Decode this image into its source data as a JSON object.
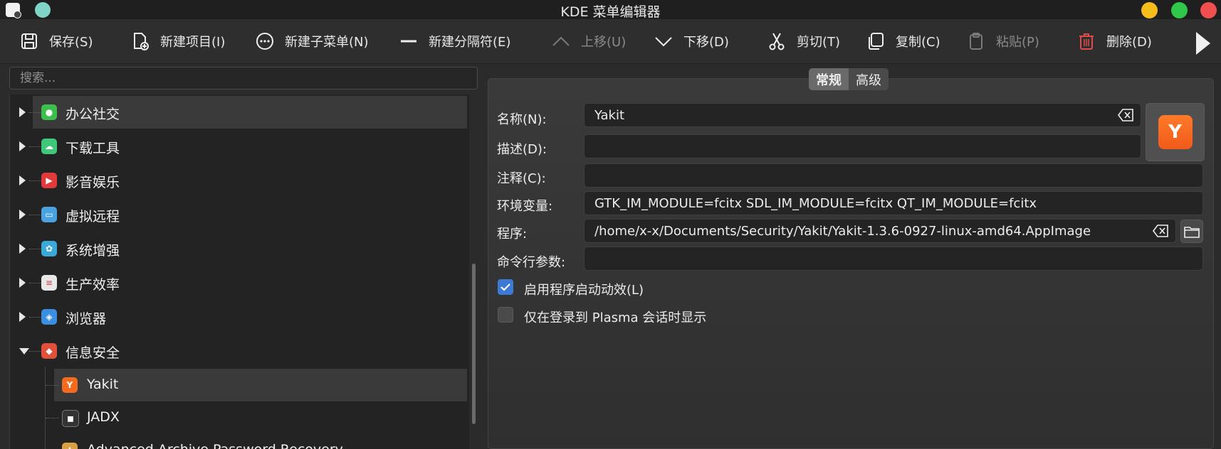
{
  "window": {
    "title": "KDE 菜单编辑器"
  },
  "toolbar": {
    "save": "保存(S)",
    "new_item": "新建项目(I)",
    "new_submenu": "新建子菜单(N)",
    "new_separator": "新建分隔符(E)",
    "move_up": "上移(U)",
    "move_down": "下移(D)",
    "cut": "剪切(T)",
    "copy": "复制(C)",
    "paste": "粘贴(P)",
    "delete": "删除(D)"
  },
  "search": {
    "placeholder": "搜索..."
  },
  "tree": {
    "categories": [
      {
        "label": "办公社交",
        "icon": "wechat-icon",
        "color": "#3dbf4e"
      },
      {
        "label": "下载工具",
        "icon": "cloud-download-icon",
        "color": "#3fc77a"
      },
      {
        "label": "影音娱乐",
        "icon": "media-play-icon",
        "color": "#e23a3a"
      },
      {
        "label": "虚拟远程",
        "icon": "remote-desktop-icon",
        "color": "#4aa3e0"
      },
      {
        "label": "系统增强",
        "icon": "system-tweak-icon",
        "color": "#3aa9d8"
      },
      {
        "label": "生产效率",
        "icon": "notes-icon",
        "color": "#e8e8e8"
      },
      {
        "label": "浏览器",
        "icon": "browser-icon",
        "color": "#3a8fe0"
      },
      {
        "label": "信息安全",
        "icon": "security-shield-icon",
        "color": "#e0503a"
      }
    ],
    "children": [
      {
        "label": "Yakit",
        "icon": "yakit-icon",
        "color": "#f46a1e"
      },
      {
        "label": "JADX",
        "icon": "jadx-icon",
        "color": "#333333"
      },
      {
        "label": "Advanced Archive Password Recovery",
        "icon": "archive-recovery-icon",
        "color": "#d8a040"
      }
    ]
  },
  "tabs": {
    "general": "常规",
    "advanced": "高级"
  },
  "form": {
    "name_label": "名称(N):",
    "name_value": "Yakit",
    "description_label": "描述(D):",
    "description_value": "",
    "comment_label": "注释(C):",
    "comment_value": "",
    "env_label": "环境变量:",
    "env_value": "GTK_IM_MODULE=fcitx SDL_IM_MODULE=fcitx QT_IM_MODULE=fcitx",
    "program_label": "程序:",
    "program_value": "/home/x-x/Documents/Security/Yakit/Yakit-1.3.6-0927-linux-amd64.AppImage",
    "args_label": "命令行参数:",
    "args_value": "",
    "launch_feedback_label": "启用程序启动动效(L)",
    "launch_feedback_checked": true,
    "plasma_only_label": "仅在登录到 Plasma 会话时显示",
    "plasma_only_checked": false
  },
  "colors": {
    "accent": "#3d7ad6",
    "delete_icon": "#e04a4a",
    "yakit_orange": "#f46a1e"
  }
}
